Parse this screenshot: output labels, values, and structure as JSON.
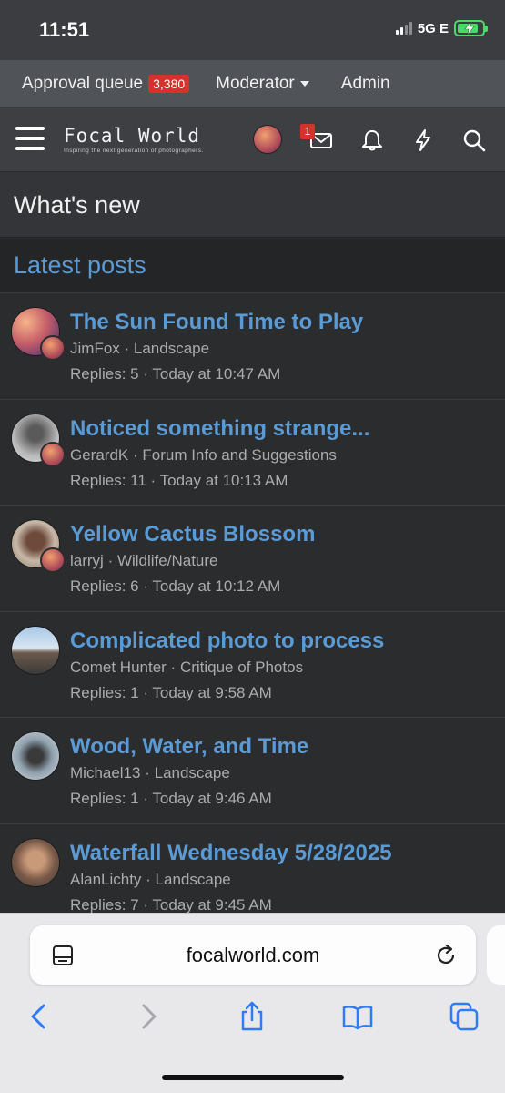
{
  "status_bar": {
    "time": "11:51",
    "network": "5G E"
  },
  "moderator_bar": {
    "approval_queue_label": "Approval queue",
    "approval_queue_count": "3,380",
    "moderator_label": "Moderator",
    "admin_label": "Admin"
  },
  "header": {
    "logo_text": "Focal World",
    "logo_tagline": "Inspiring the next generation of photographers.",
    "messages_badge": "1",
    "icons": [
      "menu-icon",
      "avatar",
      "envelope-icon",
      "bell-icon",
      "bolt-icon",
      "search-icon"
    ]
  },
  "page": {
    "title": "What's new",
    "section_title": "Latest posts"
  },
  "posts": [
    {
      "title": "The Sun Found Time to Play",
      "author": "JimFox",
      "forum": "Landscape",
      "replies": "Replies: 5",
      "time": "Today at 10:47 AM"
    },
    {
      "title": "Noticed something strange...",
      "author": "GerardK",
      "forum": "Forum Info and Suggestions",
      "replies": "Replies: 11",
      "time": "Today at 10:13 AM"
    },
    {
      "title": "Yellow Cactus Blossom",
      "author": "larryj",
      "forum": "Wildlife/Nature",
      "replies": "Replies: 6",
      "time": "Today at 10:12 AM"
    },
    {
      "title": "Complicated photo to process",
      "author": "Comet Hunter",
      "forum": "Critique of Photos",
      "replies": "Replies: 1",
      "time": "Today at 9:58 AM"
    },
    {
      "title": "Wood, Water, and Time",
      "author": "Michael13",
      "forum": "Landscape",
      "replies": "Replies: 1",
      "time": "Today at 9:46 AM"
    },
    {
      "title": "Waterfall Wednesday 5/28/2025",
      "author": "AlanLichty",
      "forum": "Landscape",
      "replies": "Replies: 7",
      "time": "Today at 9:45 AM"
    }
  ],
  "browser": {
    "url": "focalworld.com",
    "toolbar_icons": [
      "back-icon",
      "forward-icon",
      "share-icon",
      "bookmarks-icon",
      "tabs-icon"
    ]
  },
  "colors": {
    "link_blue": "#5b9bd5",
    "badge_red": "#d7312c",
    "ios_blue": "#2f7cf6"
  }
}
